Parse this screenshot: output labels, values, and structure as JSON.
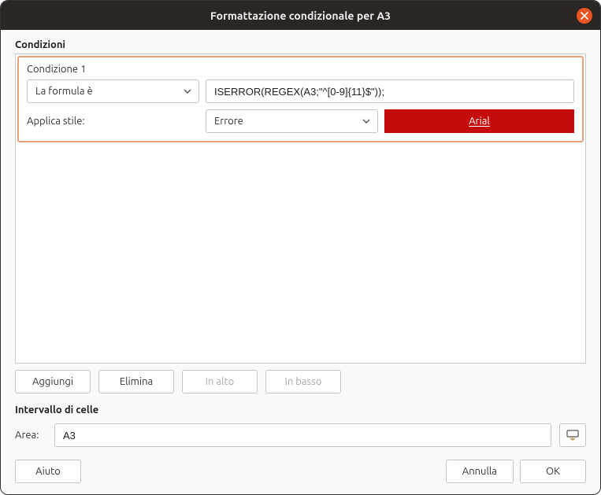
{
  "window": {
    "title": "Formattazione condizionale per A3"
  },
  "sections": {
    "conditions_title": "Condizioni",
    "range_title": "Intervallo di celle"
  },
  "condition": {
    "label": "Condizione 1",
    "type_select": "La formula è",
    "formula_value": "ISERROR(REGEX(A3;\"^[0-9]{11}$\"));",
    "apply_style_label": "Applica stile:",
    "style_select": "Errore",
    "preview_text": "Arial"
  },
  "buttons": {
    "add": "Aggiungi",
    "delete": "Elimina",
    "up": "In alto",
    "down": "In basso",
    "help": "Aiuto",
    "cancel": "Annulla",
    "ok": "OK"
  },
  "range": {
    "label": "Area:",
    "value": "A3"
  }
}
